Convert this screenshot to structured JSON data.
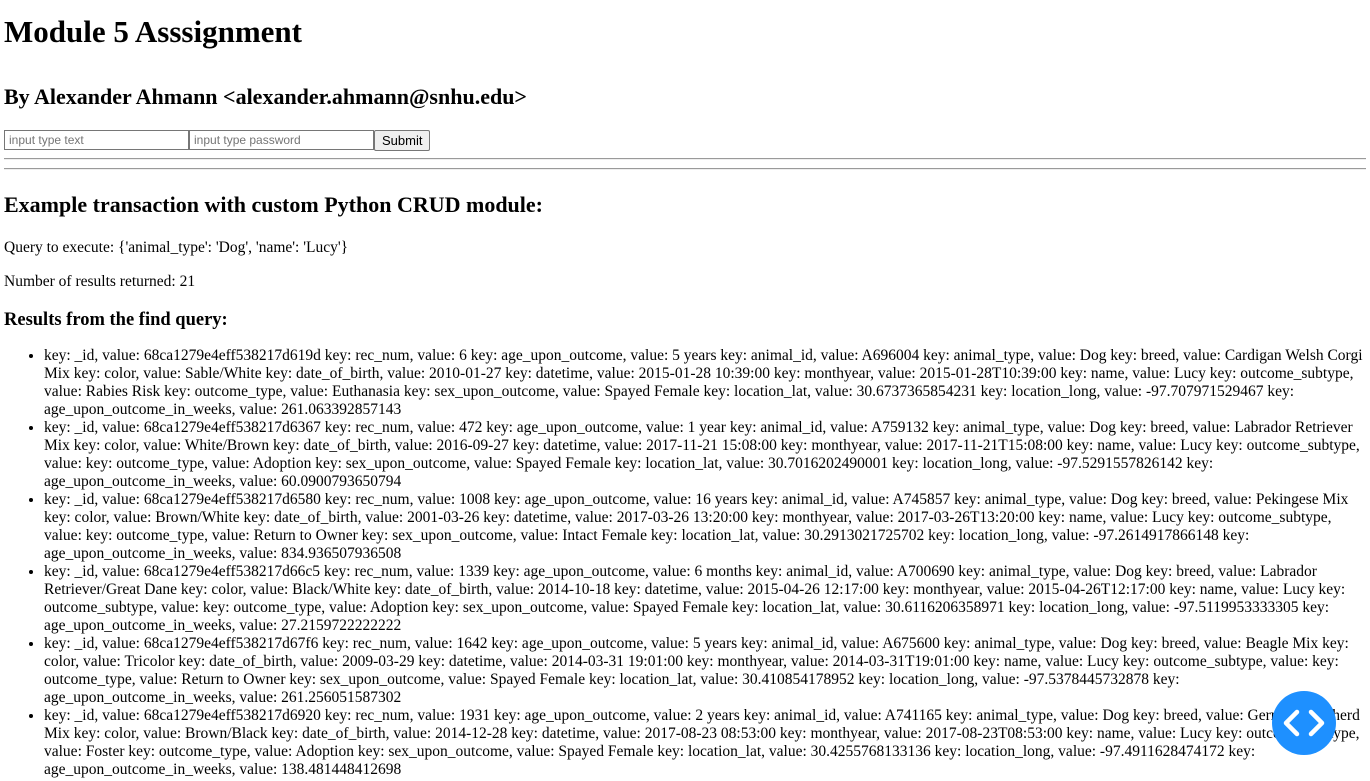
{
  "page": {
    "title": "Module 5 Asssignment",
    "author": "By Alexander Ahmann <alexander.ahmann@snhu.edu>"
  },
  "login_form": {
    "text_placeholder": "input type text",
    "password_placeholder": "input type password",
    "submit_label": "Submit"
  },
  "section": {
    "heading": "Example transaction with custom Python CRUD module:",
    "query_text": "Query to execute: {'animal_type': 'Dog', 'name': 'Lucy'}",
    "count_text": "Number of results returned: 21",
    "results_heading": "Results from the find query:"
  },
  "results": [
    "key: _id, value: 68ca1279e4eff538217d619d key: rec_num, value: 6 key: age_upon_outcome, value: 5 years key: animal_id, value: A696004 key: animal_type, value: Dog key: breed, value: Cardigan Welsh Corgi Mix key: color, value: Sable/White key: date_of_birth, value: 2010-01-27 key: datetime, value: 2015-01-28 10:39:00 key: monthyear, value: 2015-01-28T10:39:00 key: name, value: Lucy key: outcome_subtype, value: Rabies Risk key: outcome_type, value: Euthanasia key: sex_upon_outcome, value: Spayed Female key: location_lat, value: 30.6737365854231 key: location_long, value: -97.707971529467 key: age_upon_outcome_in_weeks, value: 261.063392857143",
    "key: _id, value: 68ca1279e4eff538217d6367 key: rec_num, value: 472 key: age_upon_outcome, value: 1 year key: animal_id, value: A759132 key: animal_type, value: Dog key: breed, value: Labrador Retriever Mix key: color, value: White/Brown key: date_of_birth, value: 2016-09-27 key: datetime, value: 2017-11-21 15:08:00 key: monthyear, value: 2017-11-21T15:08:00 key: name, value: Lucy key: outcome_subtype, value: key: outcome_type, value: Adoption key: sex_upon_outcome, value: Spayed Female key: location_lat, value: 30.7016202490001 key: location_long, value: -97.5291557826142 key: age_upon_outcome_in_weeks, value: 60.0900793650794",
    "key: _id, value: 68ca1279e4eff538217d6580 key: rec_num, value: 1008 key: age_upon_outcome, value: 16 years key: animal_id, value: A745857 key: animal_type, value: Dog key: breed, value: Pekingese Mix key: color, value: Brown/White key: date_of_birth, value: 2001-03-26 key: datetime, value: 2017-03-26 13:20:00 key: monthyear, value: 2017-03-26T13:20:00 key: name, value: Lucy key: outcome_subtype, value: key: outcome_type, value: Return to Owner key: sex_upon_outcome, value: Intact Female key: location_lat, value: 30.2913021725702 key: location_long, value: -97.2614917866148 key: age_upon_outcome_in_weeks, value: 834.936507936508",
    "key: _id, value: 68ca1279e4eff538217d66c5 key: rec_num, value: 1339 key: age_upon_outcome, value: 6 months key: animal_id, value: A700690 key: animal_type, value: Dog key: breed, value: Labrador Retriever/Great Dane key: color, value: Black/White key: date_of_birth, value: 2014-10-18 key: datetime, value: 2015-04-26 12:17:00 key: monthyear, value: 2015-04-26T12:17:00 key: name, value: Lucy key: outcome_subtype, value: key: outcome_type, value: Adoption key: sex_upon_outcome, value: Spayed Female key: location_lat, value: 30.6116206358971 key: location_long, value: -97.5119953333305 key: age_upon_outcome_in_weeks, value: 27.2159722222222",
    "key: _id, value: 68ca1279e4eff538217d67f6 key: rec_num, value: 1642 key: age_upon_outcome, value: 5 years key: animal_id, value: A675600 key: animal_type, value: Dog key: breed, value: Beagle Mix key: color, value: Tricolor key: date_of_birth, value: 2009-03-29 key: datetime, value: 2014-03-31 19:01:00 key: monthyear, value: 2014-03-31T19:01:00 key: name, value: Lucy key: outcome_subtype, value: key: outcome_type, value: Return to Owner key: sex_upon_outcome, value: Spayed Female key: location_lat, value: 30.410854178952 key: location_long, value: -97.5378445732878 key: age_upon_outcome_in_weeks, value: 261.256051587302",
    "key: _id, value: 68ca1279e4eff538217d6920 key: rec_num, value: 1931 key: age_upon_outcome, value: 2 years key: animal_id, value: A741165 key: animal_type, value: Dog key: breed, value: German Shepherd Mix key: color, value: Brown/Black key: date_of_birth, value: 2014-12-28 key: datetime, value: 2017-08-23 08:53:00 key: monthyear, value: 2017-08-23T08:53:00 key: name, value: Lucy key: outcome_subtype, value: Foster key: outcome_type, value: Adoption key: sex_upon_outcome, value: Spayed Female key: location_lat, value: 30.4255768133136 key: location_long, value: -97.4911628474172 key: age_upon_outcome_in_weeks, value: 138.481448412698"
  ],
  "fab": {
    "icon": "code-icon",
    "color": "#1e90ff"
  }
}
